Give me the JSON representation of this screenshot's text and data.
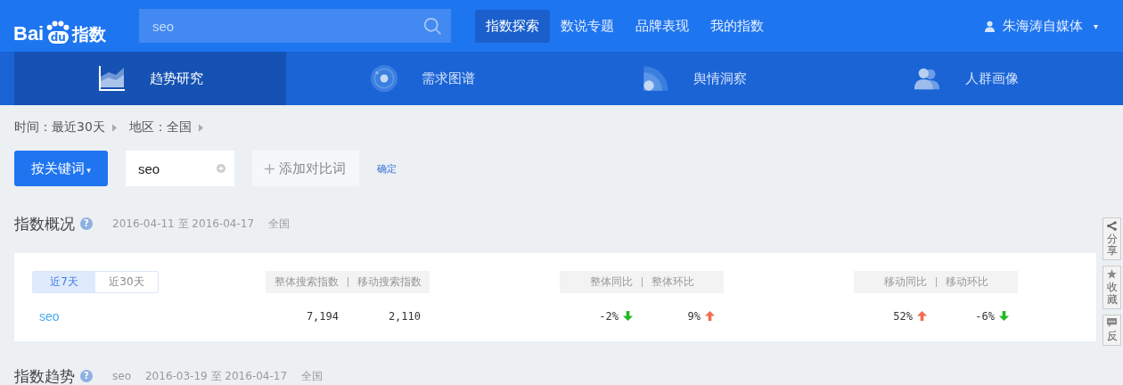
{
  "logo": {
    "part1": "Bai",
    "paw": "du",
    "part2": "指数"
  },
  "search": {
    "value": "seo"
  },
  "nav": [
    {
      "label": "指数探索",
      "selected": true
    },
    {
      "label": "数说专题",
      "selected": false
    },
    {
      "label": "品牌表现",
      "selected": false
    },
    {
      "label": "我的指数",
      "selected": false
    }
  ],
  "user": {
    "name": "朱海涛自媒体",
    "caret": "▾"
  },
  "subnav": [
    {
      "label": "趋势研究",
      "kind": "trend",
      "selected": true
    },
    {
      "label": "需求图谱",
      "kind": "orbit",
      "selected": false
    },
    {
      "label": "舆情洞察",
      "kind": "signal",
      "selected": false
    },
    {
      "label": "人群画像",
      "kind": "people",
      "selected": false
    }
  ],
  "filters": [
    {
      "label": "时间：最近30天"
    },
    {
      "label": "地区：全国"
    }
  ],
  "query": {
    "mode_button": "按关键词",
    "mode_caret": "▾",
    "keyword": "seo",
    "add_placeholder": "添加对比词",
    "confirm": "确定"
  },
  "overview": {
    "title": "指数概况",
    "help": "?",
    "meta": [
      "2016-04-11 至 2016-04-17",
      "全国"
    ],
    "periods": [
      {
        "label": "近7天",
        "selected": true
      },
      {
        "label": "近30天",
        "selected": false
      }
    ],
    "groups": [
      {
        "labels": [
          "整体搜索指数",
          "移动搜索指数"
        ]
      },
      {
        "labels": [
          "整体同比",
          "整体环比"
        ]
      },
      {
        "labels": [
          "移动同比",
          "移动环比"
        ]
      }
    ],
    "row": {
      "keyword": "seo",
      "cells": [
        [
          {
            "text": "7,194",
            "kind": "plain"
          },
          {
            "text": "2,110",
            "kind": "plain"
          }
        ],
        [
          {
            "text": "-2%",
            "kind": "down"
          },
          {
            "text": "9%",
            "kind": "up"
          }
        ],
        [
          {
            "text": "52%",
            "kind": "up"
          },
          {
            "text": "-6%",
            "kind": "down"
          }
        ]
      ]
    }
  },
  "trend": {
    "title": "指数趋势",
    "help": "?",
    "meta": [
      "seo",
      "2016-03-19 至 2016-04-17",
      "全国"
    ]
  },
  "side_tools": [
    {
      "label": "分享",
      "kind": "share"
    },
    {
      "label": "收藏",
      "kind": "star"
    },
    {
      "label": "反",
      "kind": "chat"
    }
  ]
}
